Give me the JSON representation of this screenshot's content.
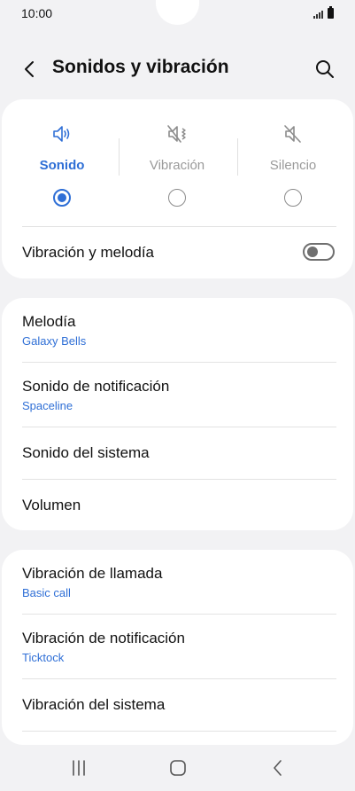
{
  "status_bar": {
    "time": "10:00"
  },
  "header": {
    "title": "Sonidos y vibración"
  },
  "sound_modes": [
    {
      "label": "Sonido",
      "icon": "speaker-icon",
      "selected": true
    },
    {
      "label": "Vibración",
      "icon": "vibrate-icon",
      "selected": false
    },
    {
      "label": "Silencio",
      "icon": "mute-icon",
      "selected": false
    }
  ],
  "vibrate_ring": {
    "label": "Vibración y melodía",
    "enabled": false
  },
  "sounds_section": [
    {
      "label": "Melodía",
      "value": "Galaxy Bells"
    },
    {
      "label": "Sonido de notificación",
      "value": "Spaceline"
    },
    {
      "label": "Sonido del sistema"
    },
    {
      "label": "Volumen"
    }
  ],
  "vibration_section": [
    {
      "label": "Vibración de llamada",
      "value": "Basic call"
    },
    {
      "label": "Vibración de notificación",
      "value": "Ticktock"
    },
    {
      "label": "Vibración del sistema"
    }
  ],
  "colors": {
    "accent": "#2f6fd6",
    "background": "#f2f2f4",
    "card": "#ffffff"
  }
}
